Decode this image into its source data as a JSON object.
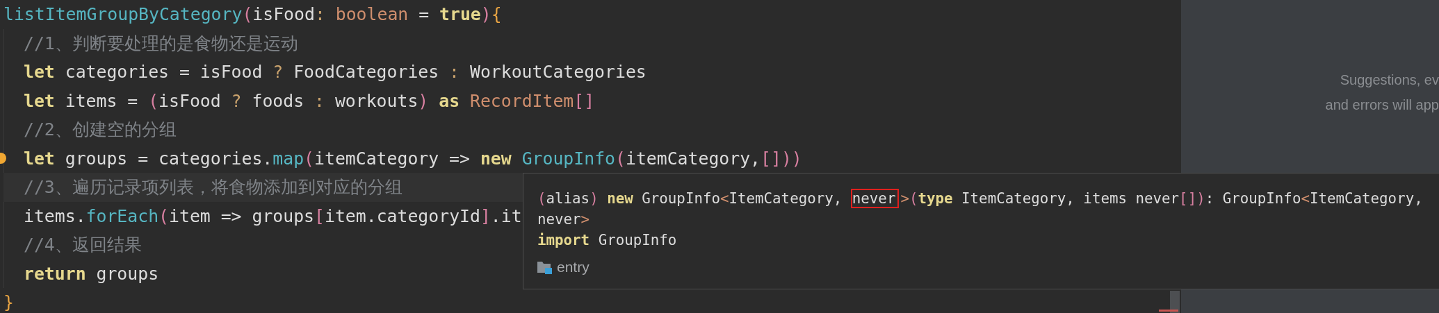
{
  "editor": {
    "blocks": [
      {
        "current": false,
        "bulb": false,
        "tokens": [
          {
            "kind": "function",
            "text": "listItemGroupByCategory"
          },
          {
            "kind": "paren",
            "text": "("
          },
          {
            "kind": "plain",
            "text": "isFood"
          },
          {
            "kind": "operator",
            "text": ": "
          },
          {
            "kind": "type",
            "text": "boolean"
          },
          {
            "kind": "plain",
            "text": " = "
          },
          {
            "kind": "keyword",
            "text": "true"
          },
          {
            "kind": "paren",
            "text": ")"
          },
          {
            "kind": "brace",
            "text": "{"
          }
        ],
        "children": [
          {
            "current": false,
            "bulb": false,
            "tokens": [
              {
                "kind": "comment",
                "text": "//1、判断要处理的是食物还是运动"
              }
            ]
          },
          {
            "current": false,
            "bulb": false,
            "tokens": [
              {
                "kind": "keyword",
                "text": "let "
              },
              {
                "kind": "plain",
                "text": "categories = isFood "
              },
              {
                "kind": "operator",
                "text": "? "
              },
              {
                "kind": "plain",
                "text": "FoodCategories "
              },
              {
                "kind": "operator",
                "text": ": "
              },
              {
                "kind": "plain",
                "text": "WorkoutCategories"
              }
            ]
          },
          {
            "current": false,
            "bulb": false,
            "tokens": [
              {
                "kind": "keyword",
                "text": "let "
              },
              {
                "kind": "plain",
                "text": "items = "
              },
              {
                "kind": "paren",
                "text": "("
              },
              {
                "kind": "plain",
                "text": "isFood "
              },
              {
                "kind": "operator",
                "text": "? "
              },
              {
                "kind": "plain",
                "text": "foods "
              },
              {
                "kind": "operator",
                "text": ": "
              },
              {
                "kind": "plain",
                "text": "workouts"
              },
              {
                "kind": "paren",
                "text": ") "
              },
              {
                "kind": "keyword",
                "text": "as "
              },
              {
                "kind": "type",
                "text": "RecordItem"
              },
              {
                "kind": "paren",
                "text": "[]"
              }
            ]
          },
          {
            "current": false,
            "bulb": false,
            "tokens": [
              {
                "kind": "comment",
                "text": "//2、创建空的分组"
              }
            ]
          },
          {
            "current": false,
            "bulb": true,
            "tokens": [
              {
                "kind": "keyword",
                "text": "let "
              },
              {
                "kind": "plain",
                "text": "groups = categories."
              },
              {
                "kind": "function",
                "text": "map"
              },
              {
                "kind": "paren",
                "text": "("
              },
              {
                "kind": "plain",
                "text": "itemCategory => "
              },
              {
                "kind": "keyword",
                "text": "new "
              },
              {
                "kind": "function",
                "text": "GroupInfo"
              },
              {
                "kind": "paren",
                "text": "("
              },
              {
                "kind": "plain",
                "text": "itemCategory,"
              },
              {
                "kind": "paren",
                "text": "[]))"
              }
            ]
          },
          {
            "current": true,
            "bulb": false,
            "tokens": [
              {
                "kind": "comment",
                "text": "//3、遍历记录项列表，将食物添加到对应的分组"
              }
            ]
          },
          {
            "current": false,
            "bulb": false,
            "tokens": [
              {
                "kind": "plain",
                "text": "items."
              },
              {
                "kind": "function",
                "text": "forEach"
              },
              {
                "kind": "paren",
                "text": "("
              },
              {
                "kind": "plain",
                "text": "item => groups"
              },
              {
                "kind": "paren",
                "text": "["
              },
              {
                "kind": "plain",
                "text": "item.categoryId"
              },
              {
                "kind": "paren",
                "text": "]"
              },
              {
                "kind": "plain",
                "text": ".it"
              }
            ]
          },
          {
            "current": false,
            "bulb": false,
            "tokens": [
              {
                "kind": "comment",
                "text": "//4、返回结果"
              }
            ]
          },
          {
            "current": false,
            "bulb": false,
            "tokens": [
              {
                "kind": "keyword",
                "text": "return "
              },
              {
                "kind": "plain",
                "text": "groups"
              }
            ]
          }
        ]
      },
      {
        "current": false,
        "bulb": false,
        "tokens": [
          {
            "kind": "brace",
            "text": "}"
          }
        ]
      }
    ]
  },
  "tooltip": {
    "lines": [
      [
        {
          "kind": "paren",
          "text": "("
        },
        {
          "kind": "plain",
          "text": "alias"
        },
        {
          "kind": "paren",
          "text": ") "
        },
        {
          "kind": "keyword",
          "text": "new "
        },
        {
          "kind": "plain",
          "text": "GroupInfo"
        },
        {
          "kind": "type",
          "text": "<"
        },
        {
          "kind": "plain",
          "text": "ItemCategory, "
        },
        {
          "kind": "plain",
          "text": "never",
          "marked": true
        },
        {
          "kind": "type",
          "text": ">"
        },
        {
          "kind": "paren",
          "text": "("
        },
        {
          "kind": "keyword",
          "text": "type "
        },
        {
          "kind": "plain",
          "text": "ItemCategory, items never"
        },
        {
          "kind": "paren",
          "text": "[])"
        },
        {
          "kind": "plain",
          "text": ": GroupInfo"
        },
        {
          "kind": "type",
          "text": "<"
        },
        {
          "kind": "plain",
          "text": "ItemCategory,"
        }
      ],
      [
        {
          "kind": "plain",
          "text": "never"
        },
        {
          "kind": "type",
          "text": ">"
        }
      ],
      [
        {
          "kind": "keyword",
          "text": "import "
        },
        {
          "kind": "plain",
          "text": "GroupInfo"
        }
      ]
    ],
    "module": "entry"
  },
  "side_panel": {
    "lines": [
      "Suggestions, ev",
      "and errors will app"
    ]
  }
}
